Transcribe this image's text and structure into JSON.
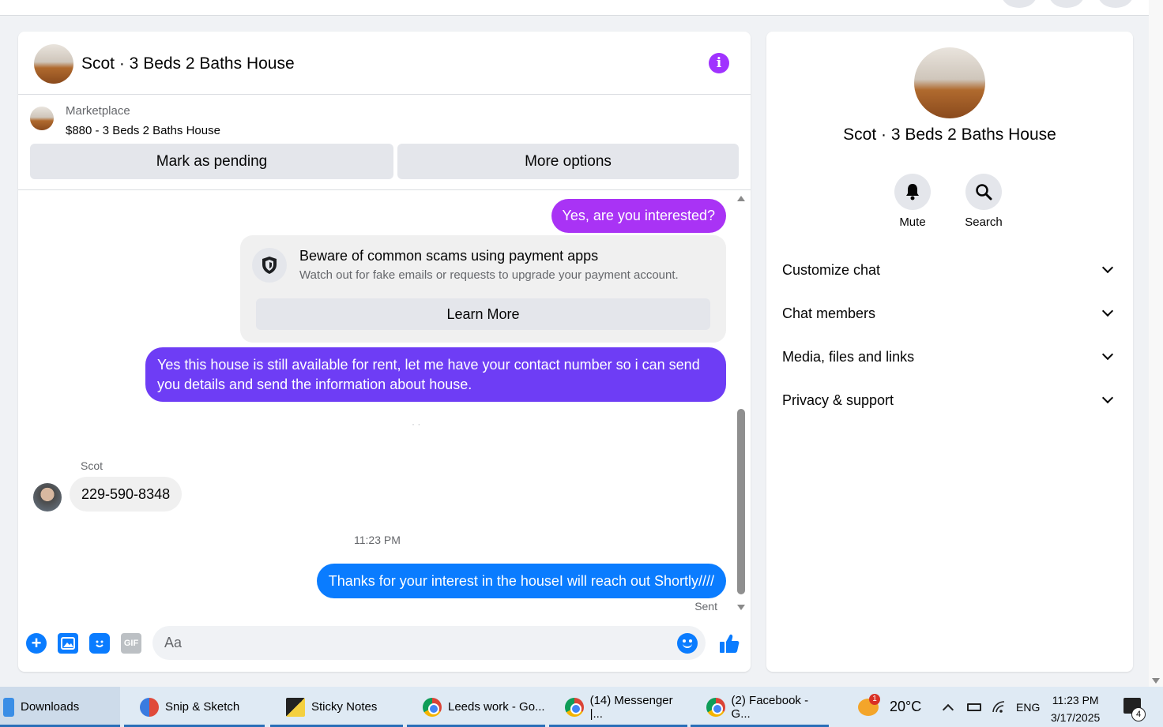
{
  "chat": {
    "title": "Scot · 3 Beds 2 Baths House",
    "marketplace": {
      "label": "Marketplace",
      "item": "$880 - 3 Beds 2 Baths House",
      "pending_button": "Mark as pending",
      "more_button": "More options"
    },
    "messages": {
      "outgoing_1": "Yes, are you interested?",
      "scam_title": "Beware of common scams using payment apps",
      "scam_desc": "Watch out for fake emails or requests to upgrade your payment account.",
      "learn_more": "Learn More",
      "outgoing_2": "Yes this house is still available for rent, let me have your contact number so i can send you details and send the information about house.",
      "sender_name": "Scot",
      "incoming_phone": "229-590-8348",
      "timestamp": "11:23 PM",
      "outgoing_3": "Thanks for your interest in the houseI will reach out Shortly////",
      "status": "Sent"
    },
    "composer": {
      "placeholder": "Aa",
      "gif_label": "GIF"
    }
  },
  "info_panel": {
    "name": "Scot · 3 Beds 2 Baths House",
    "actions": [
      {
        "label": "Mute",
        "icon": "bell-icon"
      },
      {
        "label": "Search",
        "icon": "search-icon"
      }
    ],
    "sections": [
      "Customize chat",
      "Chat members",
      "Media, files and links",
      "Privacy & support"
    ]
  },
  "taskbar": {
    "items": [
      {
        "label": "Downloads",
        "icon": "downloads-icon"
      },
      {
        "label": "Snip & Sketch",
        "icon": "snip-sketch-icon"
      },
      {
        "label": "Sticky Notes",
        "icon": "sticky-notes-icon"
      },
      {
        "label": "Leeds work - Go...",
        "icon": "chrome-icon"
      },
      {
        "label": "(14) Messenger |...",
        "icon": "chrome-icon"
      },
      {
        "label": "(2) Facebook - G...",
        "icon": "chrome-icon"
      }
    ],
    "weather": "20°C",
    "weather_badge": "1",
    "language": "ENG",
    "time": "11:23 PM",
    "date": "3/17/2025",
    "notification_count": "4"
  },
  "colors": {
    "accent_blue": "#0a7cff",
    "bubble_purple": "#a933f5",
    "bubble_violet": "#6e3df5",
    "info_purple": "#a033ff"
  }
}
